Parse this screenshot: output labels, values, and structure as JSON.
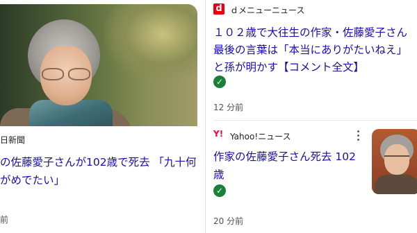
{
  "left_card": {
    "source": "日新聞",
    "title": "の佐藤愛子さんが102歳で死去 「九十何がめでたい」",
    "time": "前"
  },
  "right_card_1": {
    "logo_letter": "d",
    "source": "ｄメニューニュース",
    "title": "１０２歳で大往生の作家・佐藤愛子さん 最後の言葉は「本当にありがたいねえ」と孫が明かす【コメント全文】",
    "time": "12 分前",
    "logo_color": "#e60012"
  },
  "right_card_2": {
    "logo_text": "Y!",
    "source": "Yahoo!ニュース",
    "title": "作家の佐藤愛子さん死去 102歳",
    "time": "20 分前",
    "logo_color": "#ff0033"
  },
  "colors": {
    "link": "#1a0dab",
    "verified": "#188038"
  },
  "icons": {
    "verified": "check-circle-icon",
    "more": "more-vert-icon"
  }
}
